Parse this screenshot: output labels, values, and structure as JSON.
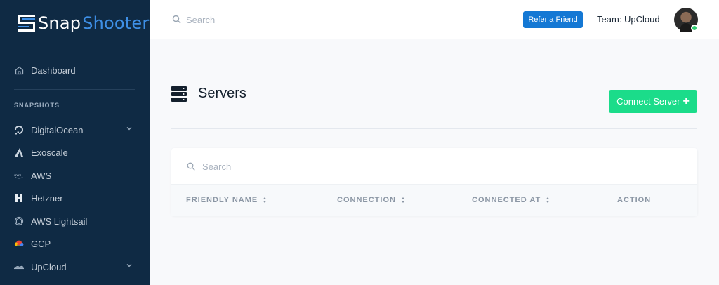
{
  "app": {
    "logo_part1": "Snap",
    "logo_part2": "Shooter"
  },
  "sidebar": {
    "dashboard": "Dashboard",
    "section_label": "SNAPSHOTS",
    "items": [
      {
        "label": "DigitalOcean",
        "icon": "digitalocean-icon",
        "has_chevron": true
      },
      {
        "label": "Exoscale",
        "icon": "exoscale-icon"
      },
      {
        "label": "AWS",
        "icon": "aws-icon"
      },
      {
        "label": "Hetzner",
        "icon": "hetzner-icon"
      },
      {
        "label": "AWS Lightsail",
        "icon": "aws-lightsail-icon"
      },
      {
        "label": "GCP",
        "icon": "gcp-icon"
      },
      {
        "label": "UpCloud",
        "icon": "upcloud-icon",
        "has_chevron": true
      }
    ]
  },
  "topbar": {
    "search_placeholder": "Search",
    "refer_label": "Refer a Friend",
    "team_label": "Team: UpCloud"
  },
  "main": {
    "title": "Servers",
    "connect_label": "Connect Server",
    "connect_plus": "+",
    "table_search_placeholder": "Search",
    "columns": [
      "FRIENDLY NAME",
      "CONNECTION",
      "CONNECTED AT",
      "ACTION"
    ]
  },
  "colors": {
    "sidebar_bg": "#0f2a44",
    "accent_blue": "#1478d4",
    "accent_green": "#1bdc8a",
    "online": "#2ecc71"
  }
}
